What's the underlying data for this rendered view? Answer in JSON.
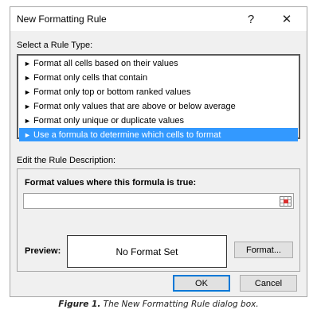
{
  "window": {
    "title": "New Formatting Rule",
    "help_glyph": "?",
    "close_glyph": "✕"
  },
  "rule_type": {
    "label": "Select a Rule Type:",
    "items": [
      {
        "label": "Format all cells based on their values",
        "selected": false
      },
      {
        "label": "Format only cells that contain",
        "selected": false
      },
      {
        "label": "Format only top or bottom ranked values",
        "selected": false
      },
      {
        "label": "Format only values that are above or below average",
        "selected": false
      },
      {
        "label": "Format only unique or duplicate values",
        "selected": false
      },
      {
        "label": "Use a formula to determine which cells to format",
        "selected": true
      }
    ],
    "arrow_glyph": "►"
  },
  "rule_description": {
    "label": "Edit the Rule Description:",
    "formula_label": "Format values where this formula is true:",
    "formula_value": "",
    "preview_label": "Preview:",
    "preview_text": "No Format Set",
    "format_button": "Format..."
  },
  "buttons": {
    "ok": "OK",
    "cancel": "Cancel"
  },
  "caption": {
    "prefix": "Figure 1.",
    "text": " The New Formatting Rule dialog box."
  },
  "colors": {
    "selection": "#3399ff",
    "dialog_bg": "#f0f0f0",
    "accent_border": "#0078d7"
  },
  "icons": {
    "help": "help-icon",
    "close": "close-icon",
    "range_selector": "range-selector-icon",
    "list_bullet": "triangle-right-icon"
  }
}
